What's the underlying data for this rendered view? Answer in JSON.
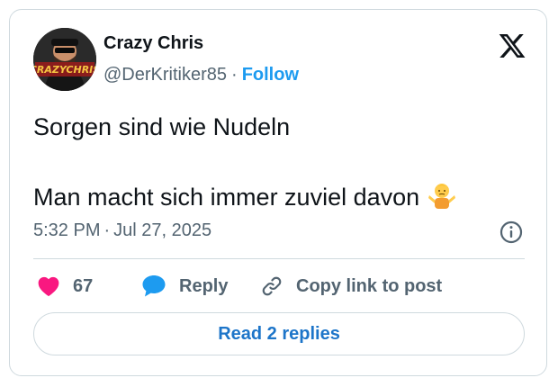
{
  "author": {
    "name": "Crazy Chris",
    "handle": "@DerKritiker85",
    "separator": "·",
    "follow_label": "Follow",
    "avatar_text": "CRAZYCHRIS"
  },
  "tweet": {
    "line1": "Sorgen sind wie Nudeln",
    "line2": "Man macht sich immer zuviel davon",
    "emoji": "person-shrugging-emoji"
  },
  "meta": {
    "time": "5:32 PM",
    "separator": "·",
    "date": "Jul 27, 2025"
  },
  "actions": {
    "like_count": "67",
    "reply_label": "Reply",
    "copy_label": "Copy link to post"
  },
  "read_replies_label": "Read 2 replies",
  "colors": {
    "accent": "#1d9bf0",
    "like": "#f91880",
    "reply_icon": "#1d9bf0",
    "muted": "#536471",
    "border": "#cfd9de"
  },
  "icons": [
    "x-logo-icon",
    "info-icon",
    "heart-icon",
    "reply-bubble-icon",
    "link-icon"
  ]
}
